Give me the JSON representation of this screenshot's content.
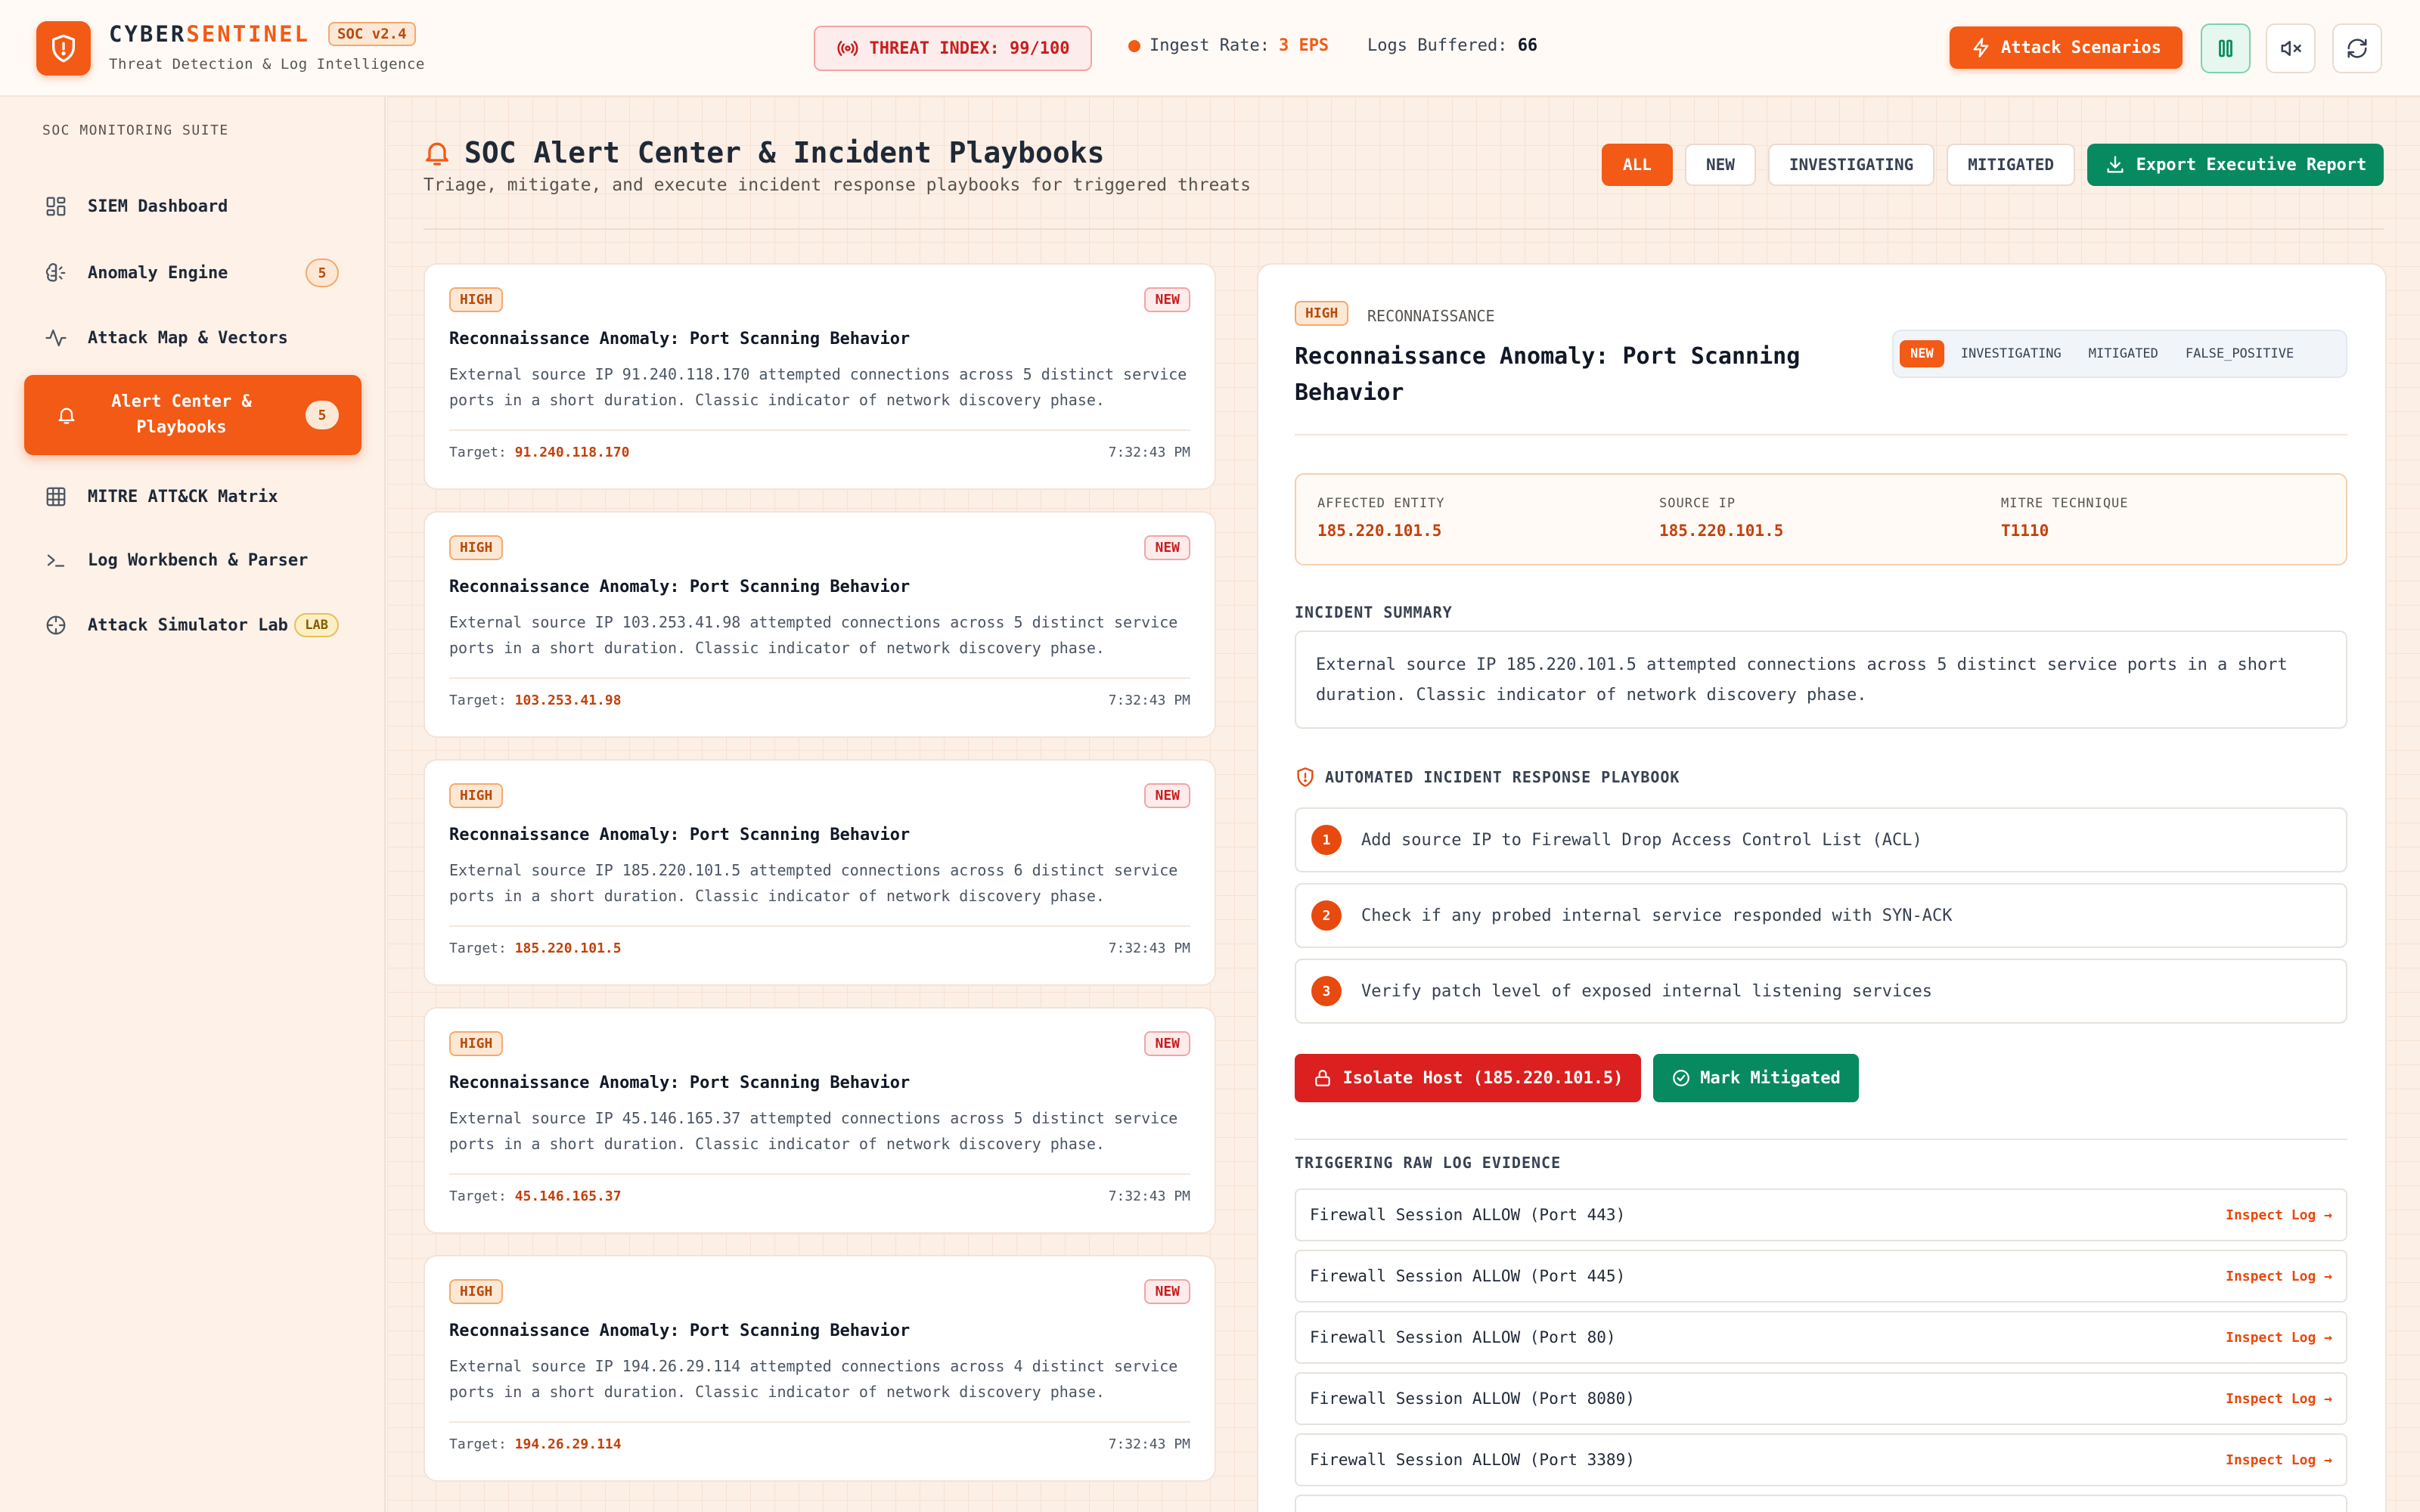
{
  "app": {
    "brand_main": "CYBER",
    "brand_accent": "SENTINEL",
    "version": "SOC v2.4",
    "subtitle": "Threat Detection & Log Intelligence",
    "accent_color": "#f25a16"
  },
  "header": {
    "threat_index": "THREAT INDEX: 99/100",
    "ingest_label": "Ingest Rate:",
    "ingest_value": "3 EPS",
    "buffered_label": "Logs Buffered:",
    "buffered_value": "66",
    "attack_button": "Attack Scenarios",
    "icons": [
      "pause-icon",
      "mute-icon",
      "refresh-icon"
    ]
  },
  "sidebar": {
    "suite_label": "SOC MONITORING SUITE",
    "items": [
      {
        "label": "SIEM Dashboard",
        "icon": "dashboard-icon",
        "badge": ""
      },
      {
        "label": "Anomaly Engine",
        "icon": "brain-icon",
        "badge": "5"
      },
      {
        "label": "Attack Map & Vectors",
        "icon": "activity-icon",
        "badge": ""
      },
      {
        "label": "Alert Center & Playbooks",
        "icon": "bell-icon",
        "badge": "5",
        "active": true
      },
      {
        "label": "MITRE ATT&CK Matrix",
        "icon": "grid-icon",
        "badge": ""
      },
      {
        "label": "Log Workbench & Parser",
        "icon": "terminal-icon",
        "badge": ""
      },
      {
        "label": "Attack Simulator Lab",
        "icon": "crosshair-icon",
        "badge": "LAB"
      }
    ]
  },
  "main": {
    "title": "SOC Alert Center & Incident Playbooks",
    "subtitle": "Triage, mitigate, and execute incident response playbooks for triggered threats",
    "filters": [
      "ALL",
      "NEW",
      "INVESTIGATING",
      "MITIGATED"
    ],
    "active_filter": "ALL",
    "export_button": "Export Executive Report"
  },
  "alerts": [
    {
      "severity": "HIGH",
      "status": "NEW",
      "title": "Reconnaissance Anomaly: Port Scanning Behavior",
      "description": "External source IP 91.240.118.170 attempted connections across 5 distinct service ports in a short duration. Classic indicator of network discovery phase.",
      "target_label": "Target:",
      "target": "91.240.118.170",
      "time": "7:32:43 PM"
    },
    {
      "severity": "HIGH",
      "status": "NEW",
      "title": "Reconnaissance Anomaly: Port Scanning Behavior",
      "description": "External source IP 103.253.41.98 attempted connections across 5 distinct service ports in a short duration. Classic indicator of network discovery phase.",
      "target_label": "Target:",
      "target": "103.253.41.98",
      "time": "7:32:43 PM"
    },
    {
      "severity": "HIGH",
      "status": "NEW",
      "title": "Reconnaissance Anomaly: Port Scanning Behavior",
      "description": "External source IP 185.220.101.5 attempted connections across 6 distinct service ports in a short duration. Classic indicator of network discovery phase.",
      "target_label": "Target:",
      "target": "185.220.101.5",
      "time": "7:32:43 PM"
    },
    {
      "severity": "HIGH",
      "status": "NEW",
      "title": "Reconnaissance Anomaly: Port Scanning Behavior",
      "description": "External source IP 45.146.165.37 attempted connections across 5 distinct service ports in a short duration. Classic indicator of network discovery phase.",
      "target_label": "Target:",
      "target": "45.146.165.37",
      "time": "7:32:43 PM"
    },
    {
      "severity": "HIGH",
      "status": "NEW",
      "title": "Reconnaissance Anomaly: Port Scanning Behavior",
      "description": "External source IP 194.26.29.114 attempted connections across 4 distinct service ports in a short duration. Classic indicator of network discovery phase.",
      "target_label": "Target:",
      "target": "194.26.29.114",
      "time": "7:32:43 PM"
    }
  ],
  "detail": {
    "severity": "HIGH",
    "category": "RECONNAISSANCE",
    "title": "Reconnaissance Anomaly: Port Scanning Behavior",
    "status_options": [
      "NEW",
      "INVESTIGATING",
      "MITIGATED",
      "FALSE_POSITIVE"
    ],
    "active_status": "NEW",
    "entities": [
      {
        "label": "AFFECTED ENTITY",
        "value": "185.220.101.5"
      },
      {
        "label": "SOURCE IP",
        "value": "185.220.101.5"
      },
      {
        "label": "MITRE TECHNIQUE",
        "value": "T1110"
      }
    ],
    "summary_label": "INCIDENT SUMMARY",
    "summary": "External source IP 185.220.101.5 attempted connections across 5 distinct service ports in a short duration. Classic indicator of network discovery phase.",
    "playbook_label": "AUTOMATED INCIDENT RESPONSE PLAYBOOK",
    "playbook_steps": [
      {
        "n": "1",
        "text": "Add source IP to Firewall Drop Access Control List (ACL)"
      },
      {
        "n": "2",
        "text": "Check if any probed internal service responded with SYN-ACK"
      },
      {
        "n": "3",
        "text": "Verify patch level of exposed internal listening services"
      }
    ],
    "isolate_button": "Isolate Host (185.220.101.5)",
    "mitigate_button": "Mark Mitigated",
    "evidence_label": "TRIGGERING RAW LOG EVIDENCE",
    "logs": [
      {
        "text": "Firewall Session ALLOW (Port 443)",
        "action": "Inspect Log →"
      },
      {
        "text": "Firewall Session ALLOW (Port 445)",
        "action": "Inspect Log →"
      },
      {
        "text": "Firewall Session ALLOW (Port 80)",
        "action": "Inspect Log →"
      },
      {
        "text": "Firewall Session ALLOW (Port 8080)",
        "action": "Inspect Log →"
      },
      {
        "text": "Firewall Session ALLOW (Port 3389)",
        "action": "Inspect Log →"
      }
    ]
  }
}
